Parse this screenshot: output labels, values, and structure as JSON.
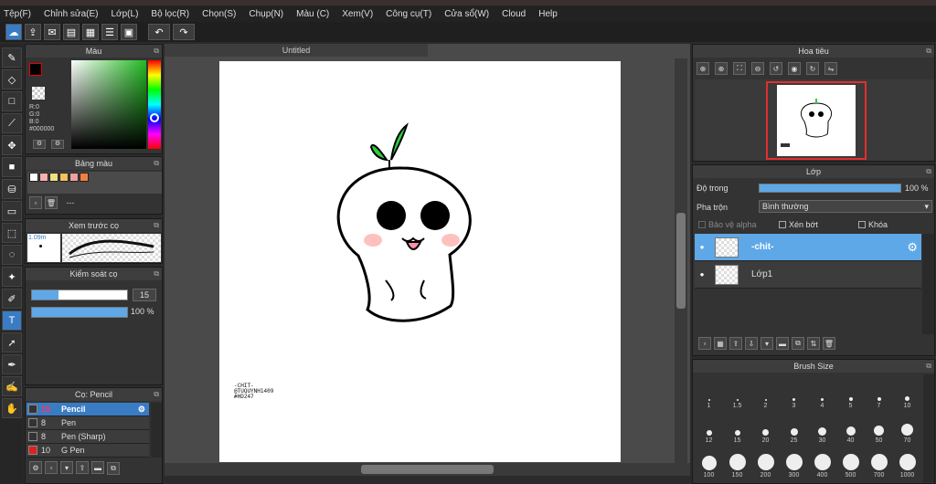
{
  "menu": [
    "Tệp(F)",
    "Chỉnh sửa(E)",
    "Lớp(L)",
    "Bộ lọc(R)",
    "Chọn(S)",
    "Chụp(N)",
    "Màu (C)",
    "Xem(V)",
    "Công cụ(T)",
    "Cửa sổ(W)",
    "Cloud",
    "Help"
  ],
  "canvas": {
    "tab_title": "Untitled",
    "signature_lines": [
      "-CHIT-",
      "@TUQUYNH1409",
      "#HD247"
    ]
  },
  "color_panel": {
    "title": "Màu",
    "r": "R:0",
    "g": "G:0",
    "b": "B:0",
    "hex": "#000000"
  },
  "palette_panel": {
    "title": "Bảng màu",
    "name": "---",
    "colors": [
      "#ffffff",
      "#f7b0b0",
      "#f0e080",
      "#f5c060",
      "#f0a0a0",
      "#f08040"
    ]
  },
  "brush_preview_panel": {
    "title": "Xem trước cọ",
    "size": "1.09m"
  },
  "brush_control_panel": {
    "title": "Kiểm soát cọ",
    "size_value": "15",
    "opacity_value": "100 %",
    "size_fraction": 0.28,
    "opacity_fraction": 1.0
  },
  "brush_list_panel": {
    "title": "Cọ: Pencil",
    "items": [
      {
        "size": "15",
        "name": "Pencil",
        "color": "#333333"
      },
      {
        "size": "8",
        "name": "Pen",
        "color": "#333333"
      },
      {
        "size": "8",
        "name": "Pen (Sharp)",
        "color": "#333333"
      },
      {
        "size": "10",
        "name": "G Pen",
        "color": "#e02020"
      }
    ]
  },
  "navigator_panel": {
    "title": "Hoa tiêu"
  },
  "layer_panel": {
    "title": "Lớp",
    "opacity_label": "Độ trong",
    "opacity_value": "100 %",
    "blend_label": "Pha trộn",
    "blend_value": "Bình thường",
    "protect_alpha": "Bảo vệ alpha",
    "clipping": "Xén bớt",
    "lock": "Khóa",
    "layers": [
      {
        "name": "-chit-",
        "active": true
      },
      {
        "name": "Lớp1",
        "active": false
      }
    ]
  },
  "brush_size_panel": {
    "title": "Brush Size",
    "sizes": [
      "1",
      "1.5",
      "2",
      "3",
      "4",
      "5",
      "7",
      "10",
      "12",
      "15",
      "20",
      "25",
      "30",
      "40",
      "50",
      "70",
      "100",
      "150",
      "200",
      "300",
      "400",
      "500",
      "700",
      "1000"
    ]
  }
}
